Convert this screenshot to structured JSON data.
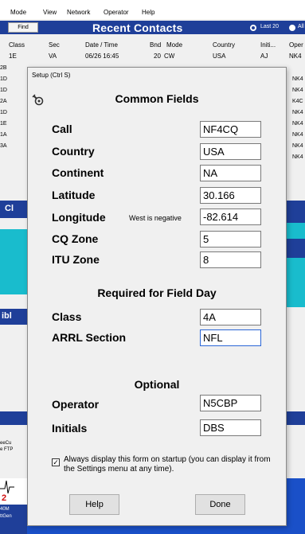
{
  "menu": [
    "Mode",
    "View",
    "Network",
    "Operator",
    "Help"
  ],
  "toolbar": {
    "find_label": "Find",
    "title": "Recent Contacts",
    "last20_label": "Last 20",
    "all_label": "All"
  },
  "table": {
    "columns": [
      "Class",
      "Sec",
      "Date  /  Time",
      "Bnd",
      "Mode",
      "Country",
      "Initi...",
      "Oper"
    ],
    "first_row": [
      "1E",
      "VA",
      "06/26  16:45",
      "20",
      "CW",
      "USA",
      "AJ",
      "NK4"
    ],
    "left_column": [
      "2B",
      "1D",
      "1D",
      "2A",
      "1D",
      "1E",
      "1A",
      "3A"
    ],
    "right_column": [
      "NK4",
      "NK4",
      "K4C",
      "NK4",
      "NK4",
      "NK4",
      "NK4",
      "NK4"
    ]
  },
  "background": {
    "left_bar_1": "Cl",
    "left_bar_2": "ibl",
    "ticker": [
      "eeCu",
      "e FTP"
    ],
    "bottom_digit": "2",
    "bottom_lines": [
      "40M",
      "ttGen"
    ],
    "colors": {
      "blue": "#1f3f99",
      "teal": "#19bccd",
      "band": "#1a50c8"
    }
  },
  "dialog": {
    "title": "Setup  (Ctrl S)",
    "icon": "wrench-gear-icon",
    "section_common": "Common Fields",
    "call_label": "Call",
    "call_value": "NF4CQ",
    "country_label": "Country",
    "country_value": "USA",
    "continent_label": "Continent",
    "continent_value": "NA",
    "latitude_label": "Latitude",
    "latitude_value": "30.166",
    "longitude_label": "Longitude",
    "longitude_hint": "West is negative",
    "longitude_value": "-82.614",
    "cq_label": "CQ Zone",
    "cq_value": "5",
    "itu_label": "ITU Zone",
    "itu_value": "8",
    "section_fieldday": "Required for Field Day",
    "class_label": "Class",
    "class_value": "4A",
    "arrl_label": "ARRL Section",
    "arrl_value": "NFL",
    "section_optional": "Optional",
    "operator_label": "Operator",
    "operator_value": "N5CBP",
    "initials_label": "Initials",
    "initials_value": "DBS",
    "startup_text": "Always display this form on startup (you can display it from the Settings menu at any time).",
    "startup_checked": true,
    "help_label": "Help",
    "done_label": "Done"
  }
}
